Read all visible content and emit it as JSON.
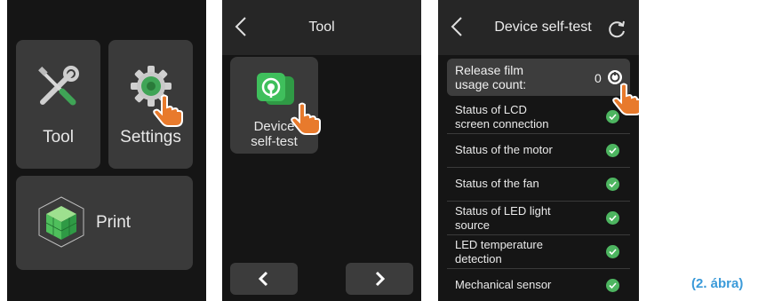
{
  "home": {
    "tool_label": "Tool",
    "settings_label": "Settings",
    "print_label": "Print"
  },
  "tool_screen": {
    "title": "Tool",
    "device_test_label_line1": "Device",
    "device_test_label_line2": "self-test"
  },
  "self_test": {
    "title": "Device self-test",
    "counter_line1": "Release film",
    "counter_line2": "usage count:",
    "counter_value": "0",
    "items": [
      {
        "line1": "Status of LCD",
        "line2": "screen connection"
      },
      {
        "line1": "Status of the motor",
        "line2": ""
      },
      {
        "line1": "Status of the fan",
        "line2": ""
      },
      {
        "line1": "Status of LED light",
        "line2": "source"
      },
      {
        "line1": "LED temperature",
        "line2": "detection"
      },
      {
        "line1": "Mechanical sensor",
        "line2": ""
      }
    ]
  },
  "caption": "(2. ábra)",
  "colors": {
    "status_ok": "#4db560",
    "accent_green": "#3fa456",
    "pointer": "#e87a2c",
    "caption": "#3a9ad9"
  },
  "icons": [
    "tools-icon",
    "gear-icon",
    "print-cube-icon",
    "device-test-icon",
    "refresh-icon",
    "reset-icon",
    "check-icon",
    "hand-pointer-icon",
    "chevron-left-icon",
    "chevron-right-icon"
  ]
}
